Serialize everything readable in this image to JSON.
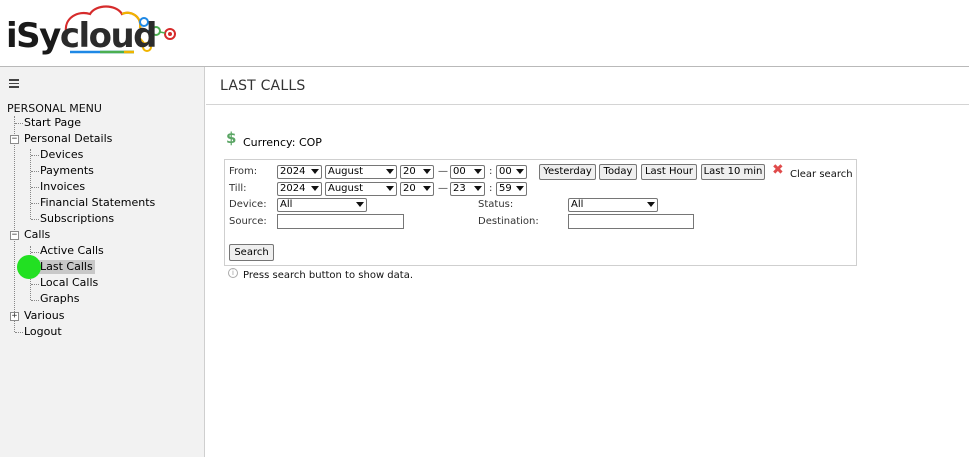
{
  "header": {
    "logo_part1": "iSy",
    "logo_part2": "cloud",
    "brand_colors": [
      "#d62b2b",
      "#f0b400",
      "#4caf50",
      "#1e88e5"
    ]
  },
  "sidebar": {
    "menu_title": "PERSONAL MENU",
    "items": [
      {
        "label": "Start Page"
      },
      {
        "label": "Personal Details",
        "toggle": "−"
      },
      {
        "label": "Devices"
      },
      {
        "label": "Payments"
      },
      {
        "label": "Invoices"
      },
      {
        "label": "Financial Statements"
      },
      {
        "label": "Subscriptions"
      },
      {
        "label": "Calls",
        "toggle": "−"
      },
      {
        "label": "Active Calls"
      },
      {
        "label": "Last Calls",
        "selected": true
      },
      {
        "label": "Local Calls"
      },
      {
        "label": "Graphs"
      },
      {
        "label": "Various",
        "toggle": "+"
      },
      {
        "label": "Logout"
      }
    ]
  },
  "main": {
    "title": "LAST CALLS",
    "currency_label": "Currency: COP",
    "currency_icon": "dollar-icon",
    "form": {
      "from_label": "From:",
      "till_label": "Till:",
      "from": {
        "year": "2024",
        "month": "August",
        "day": "20",
        "hour": "00",
        "minute": "00"
      },
      "till": {
        "year": "2024",
        "month": "August",
        "day": "20",
        "hour": "23",
        "minute": "59"
      },
      "dash": "—",
      "colon": ":",
      "quick_buttons": {
        "yesterday": "Yesterday",
        "today": "Today",
        "last_hour": "Last Hour",
        "last_10_min": "Last 10 min"
      },
      "clear_search": "Clear search",
      "device_label": "Device:",
      "device_value": "All",
      "status_label": "Status:",
      "status_value": "All",
      "source_label": "Source:",
      "destination_label": "Destination:",
      "source_value": "",
      "destination_value": "",
      "search_button": "Search"
    },
    "info_message": "Press search button to show data."
  }
}
